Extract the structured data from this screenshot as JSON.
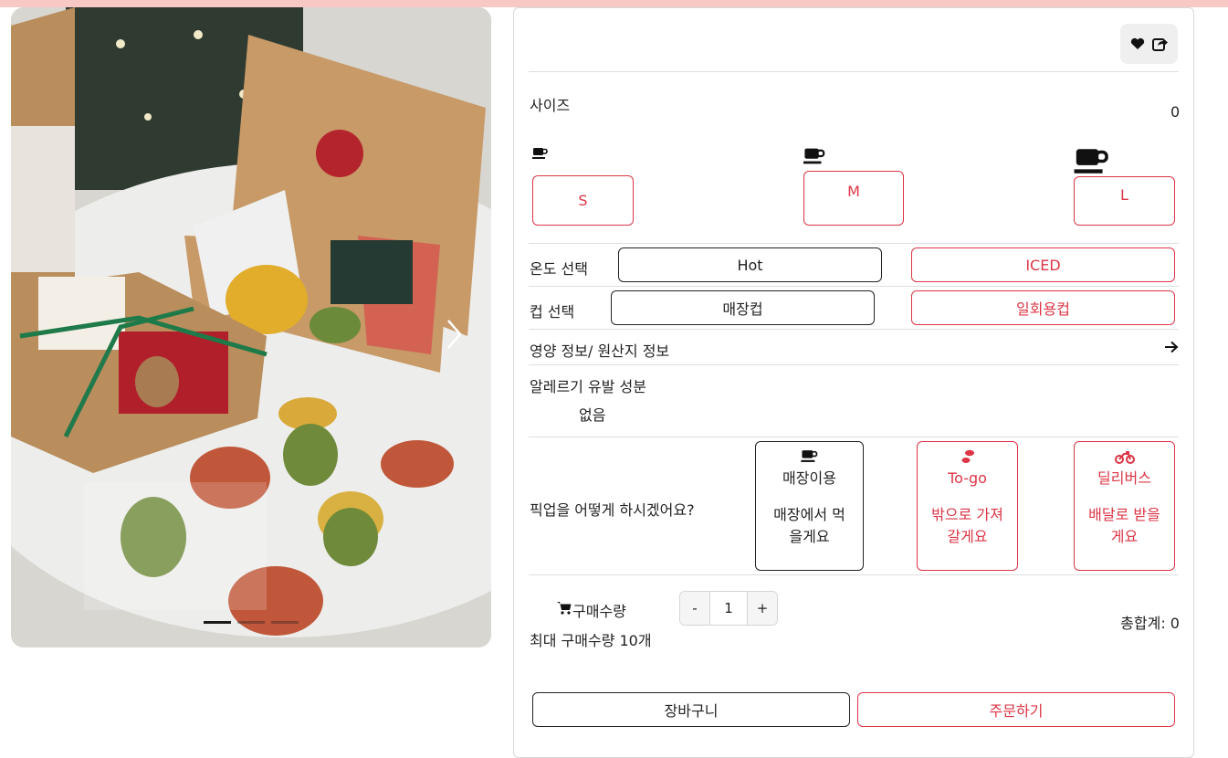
{
  "colors": {
    "accent_red": "#dc3545",
    "topbar": "#f7c8c4",
    "text": "#222222"
  },
  "carousel": {
    "indicators": 3,
    "active_index": 0,
    "next_icon": "chevron-right-icon"
  },
  "header_icons": [
    "heart-icon",
    "share-icon"
  ],
  "size": {
    "label": "사이즈",
    "price": "0",
    "options": [
      {
        "label": "S",
        "icon": "coffee-cup-icon"
      },
      {
        "label": "M",
        "icon": "coffee-cup-icon"
      },
      {
        "label": "L",
        "icon": "coffee-cup-icon"
      }
    ]
  },
  "temperature": {
    "label": "온도 선택",
    "options": [
      "Hot",
      "ICED"
    ],
    "selected": "Hot"
  },
  "cup": {
    "label": "컵 선택",
    "options": [
      "매장컵",
      "일회용컵"
    ],
    "selected": "매장컵"
  },
  "nutrition": {
    "label": "영양 정보/ 원산지 정보",
    "icon": "arrow-right-icon"
  },
  "allergy": {
    "label": "알레르기 유발 성분",
    "value": "없음"
  },
  "pickup": {
    "question": "픽업을 어떻게 하시겠어요?",
    "options": [
      {
        "title": "매장이용",
        "desc": "매장에서 먹을게요",
        "icon": "coffee-cup-icon"
      },
      {
        "title": "To-go",
        "desc": "밖으로 가져갈게요",
        "icon": "footprints-icon"
      },
      {
        "title": "딜리버스",
        "desc": "배달로 받을게요",
        "icon": "motorcycle-icon"
      }
    ],
    "selected": "매장이용"
  },
  "quantity": {
    "label": "구매수량",
    "icon": "cart-icon",
    "minus": "-",
    "value": "1",
    "plus": "+",
    "max_text": "최대 구매수량 10개",
    "total": "총합계: 0"
  },
  "actions": {
    "cart": "장바구니",
    "order": "주문하기"
  }
}
